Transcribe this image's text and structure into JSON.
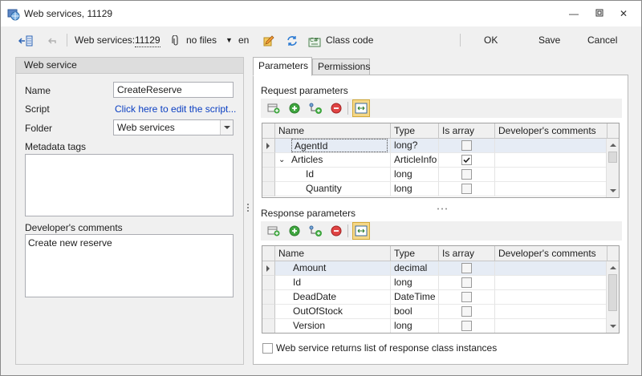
{
  "window": {
    "title": "Web services, 11129"
  },
  "toolbar": {
    "context_label": "Web services:",
    "context_id": "11129",
    "files_label": "no files",
    "language": "en",
    "class_code_label": "Class code",
    "ok_label": "OK",
    "save_label": "Save",
    "cancel_label": "Cancel"
  },
  "left_panel": {
    "header": "Web service",
    "name_label": "Name",
    "name_value": "CreateReserve",
    "script_label": "Script",
    "script_link": "Click here to edit the script...",
    "folder_label": "Folder",
    "folder_value": "Web services",
    "metadata_label": "Metadata tags",
    "metadata_value": "",
    "comments_label": "Developer's comments",
    "comments_value": "Create new reserve"
  },
  "tabs": [
    {
      "label": "Parameters",
      "active": true
    },
    {
      "label": "Permissions",
      "active": false
    }
  ],
  "columns": [
    "Name",
    "Type",
    "Is array",
    "Developer's comments"
  ],
  "request": {
    "title": "Request parameters",
    "rows": [
      {
        "name": "AgentId",
        "type": "long?",
        "is_array": false,
        "expander": "",
        "selected": true
      },
      {
        "name": "Articles",
        "type": "ArticleInfo",
        "is_array": true,
        "expander": "v",
        "selected": false
      },
      {
        "name": "Id",
        "type": "long",
        "is_array": false,
        "expander": "",
        "selected": false
      },
      {
        "name": "Quantity",
        "type": "long",
        "is_array": false,
        "expander": "",
        "selected": false
      }
    ]
  },
  "response": {
    "title": "Response parameters",
    "rows": [
      {
        "name": "Amount",
        "type": "decimal",
        "is_array": false,
        "selected": true
      },
      {
        "name": "Id",
        "type": "long",
        "is_array": false,
        "selected": false
      },
      {
        "name": "DeadDate",
        "type": "DateTime",
        "is_array": false,
        "selected": false
      },
      {
        "name": "OutOfStock",
        "type": "bool",
        "is_array": false,
        "selected": false
      },
      {
        "name": "Version",
        "type": "long",
        "is_array": false,
        "selected": false
      }
    ]
  },
  "footer": {
    "returns_list_label": "Web service returns list of response class instances",
    "returns_list_checked": false
  },
  "colors": {
    "link": "#0b3fc2",
    "selected_row": "#e6ecf5",
    "highlight_button": "#f5d787"
  }
}
